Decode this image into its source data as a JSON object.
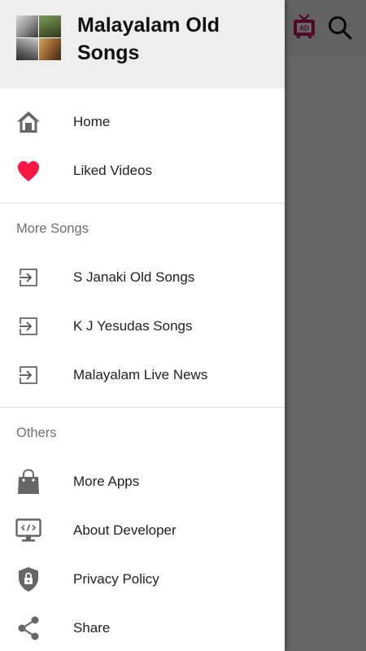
{
  "app": {
    "title": "Malayalam Old Songs"
  },
  "toolbar": {
    "tv_icon": "tv-ad-icon",
    "search_icon": "search-icon"
  },
  "drawer": {
    "title": "Malayalam Old Songs",
    "primary_items": [
      {
        "label": "Home",
        "icon": "home-icon"
      },
      {
        "label": "Liked Videos",
        "icon": "heart-icon"
      }
    ],
    "more_songs": {
      "title": "More Songs",
      "items": [
        {
          "label": "S Janaki Old Songs",
          "icon": "open-in-icon"
        },
        {
          "label": "K J Yesudas Songs",
          "icon": "open-in-icon"
        },
        {
          "label": "Malayalam Live News",
          "icon": "open-in-icon"
        }
      ]
    },
    "others": {
      "title": "Others",
      "items": [
        {
          "label": "More Apps",
          "icon": "shopping-bag-icon"
        },
        {
          "label": "About Developer",
          "icon": "monitor-code-icon"
        },
        {
          "label": "Privacy Policy",
          "icon": "shield-lock-icon"
        },
        {
          "label": "Share",
          "icon": "share-icon"
        }
      ]
    }
  },
  "colors": {
    "heart": "#ff1744",
    "icon_gray": "#666666",
    "tv_accent": "#c2185b",
    "header_bg": "#eeeeee",
    "scrim": "rgba(0,0,0,0.6)"
  }
}
